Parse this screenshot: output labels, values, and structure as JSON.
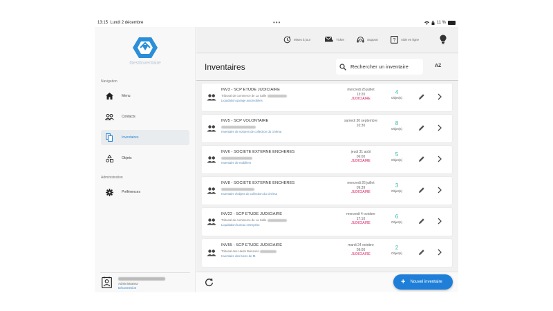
{
  "status": {
    "time": "13:15",
    "date": "Lundi 2 décembre",
    "battery": "11 %"
  },
  "app": {
    "name": "GestInventaire"
  },
  "sidebar": {
    "section_nav": "Navigation",
    "items": [
      {
        "label": "Menu",
        "icon": "home-icon"
      },
      {
        "label": "Contacts",
        "icon": "contacts-icon"
      },
      {
        "label": "Inventaires",
        "icon": "documents-icon",
        "active": true
      },
      {
        "label": "Objets",
        "icon": "shapes-icon"
      }
    ],
    "section_admin": "Administration",
    "admin_items": [
      {
        "label": "Préférences",
        "icon": "gear-icon"
      }
    ],
    "user": {
      "role": "Administrateur",
      "logout": "Déconnexion"
    }
  },
  "topbar": {
    "items": [
      {
        "label": "Mises à jour",
        "icon": "update-icon"
      },
      {
        "label": "Ticket",
        "icon": "mail-icon"
      },
      {
        "label": "Support",
        "icon": "headset-icon"
      },
      {
        "label": "Aide en ligne",
        "icon": "help-icon"
      }
    ]
  },
  "header": {
    "title": "Inventaires",
    "search_placeholder": "Rechercher un inventaire",
    "sort": "AZ"
  },
  "inventories": [
    {
      "title": "INV3 - SCP ETUDE JUDICIAIRE",
      "line1": "Tribunal de commerce de La Salle",
      "line2": "Liquidation garage automobiles",
      "date": "mercredi 26 juillet",
      "time": "13:20",
      "tag": "JUDICIAIRE",
      "count": "4",
      "unit": "Objet(s)"
    },
    {
      "title": "INV5 - SCP VOLONTAIRE",
      "line1": "",
      "line2": "Inventaire de voitures de collection du cinéma",
      "date": "samedi 30 septembre",
      "time": "10:30",
      "tag": "",
      "count": "8",
      "unit": "Objet(s)"
    },
    {
      "title": "INV6 - SOCIETE EXTERNE ENCHERES",
      "line1": "",
      "line2": "Inventaire de mobiliers",
      "date": "jeudi 31 août",
      "time": "06:00",
      "tag": "JUDICIAIRE",
      "count": "5",
      "unit": "Objet(s)"
    },
    {
      "title": "INV8 - SOCIETE EXTERNE ENCHERES",
      "line1": "",
      "line2": "Inventaire d'objets de collection du cinéma",
      "date": "mercredi 26 juillet",
      "time": "09:39",
      "tag": "JUDICIAIRE",
      "count": "3",
      "unit": "Objet(s)"
    },
    {
      "title": "INV22 - SCP ETUDE JUDICIAIRE",
      "line1": "Tribunal de commerce de La Salle",
      "line2": "Liquidation bureau entreprise",
      "date": "mercredi 4 octobre",
      "time": "17:10",
      "tag": "JUDICIAIRE",
      "count": "6",
      "unit": "Objet(s)"
    },
    {
      "title": "INV55 - SCP ETUDE JUDICIAIRE",
      "line1": "Tribunal des Hauts Buissons",
      "line2": "Inventaire des biens de M.",
      "date": "mardi 24 octobre",
      "time": "09:00",
      "tag": "JUDICIAIRE",
      "count": "2",
      "unit": "Objet(s)"
    }
  ],
  "footer": {
    "new_label": "Nouvel inventaire"
  },
  "colors": {
    "accent": "#1f7fd8",
    "count": "#3db7a5",
    "tag": "#d81b60"
  }
}
